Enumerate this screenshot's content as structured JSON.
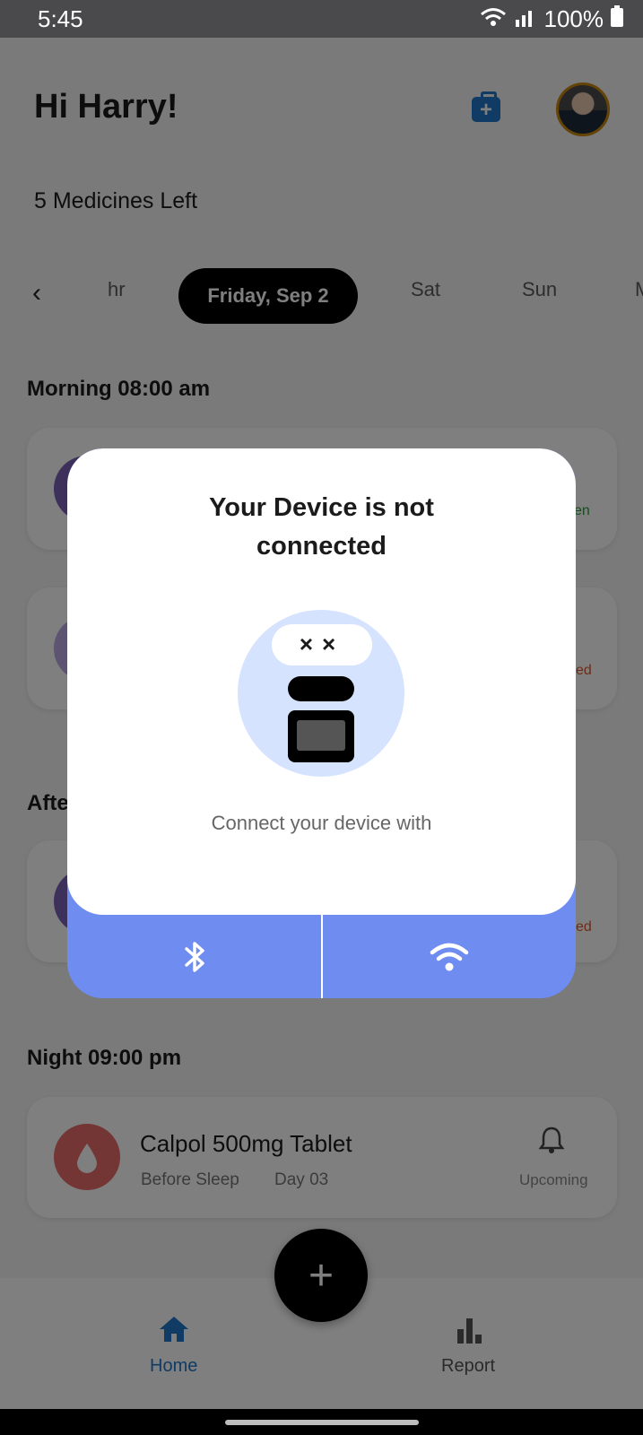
{
  "status_bar": {
    "time": "5:45",
    "battery": "100%"
  },
  "header": {
    "greeting": "Hi Harry!",
    "medicines_left": "5 Medicines Left"
  },
  "date_strip": {
    "days": [
      "hr",
      "Friday, Sep 2",
      "Sat",
      "Sun",
      "M"
    ],
    "selected": "Friday, Sep 2"
  },
  "sections": {
    "morning": "Morning 08:00 am",
    "afternoon": "Afte",
    "night": "Night 09:00 pm"
  },
  "morning_cards": [
    {
      "status": "en",
      "status_color": "#2e9a3a",
      "circle_color": "#7b62b7"
    },
    {
      "status": "ed",
      "status_color": "#e0542a",
      "circle_color": "#b9a8e0"
    }
  ],
  "afternoon_cards": [
    {
      "status": "ed",
      "status_color": "#e0542a",
      "circle_color": "#7b62b7"
    }
  ],
  "night_card": {
    "name": "Calpol 500mg Tablet",
    "timing": "Before Sleep",
    "day": "Day 03",
    "status": "Upcoming",
    "circle_color": "#e86b6b"
  },
  "bottom_nav": {
    "home": "Home",
    "report": "Report",
    "fab": "+"
  },
  "modal": {
    "title_line1": "Your Device is not",
    "title_line2": "connected",
    "eyes": "××",
    "caption": "Connect your device with",
    "accent": "#6f8cf1"
  }
}
